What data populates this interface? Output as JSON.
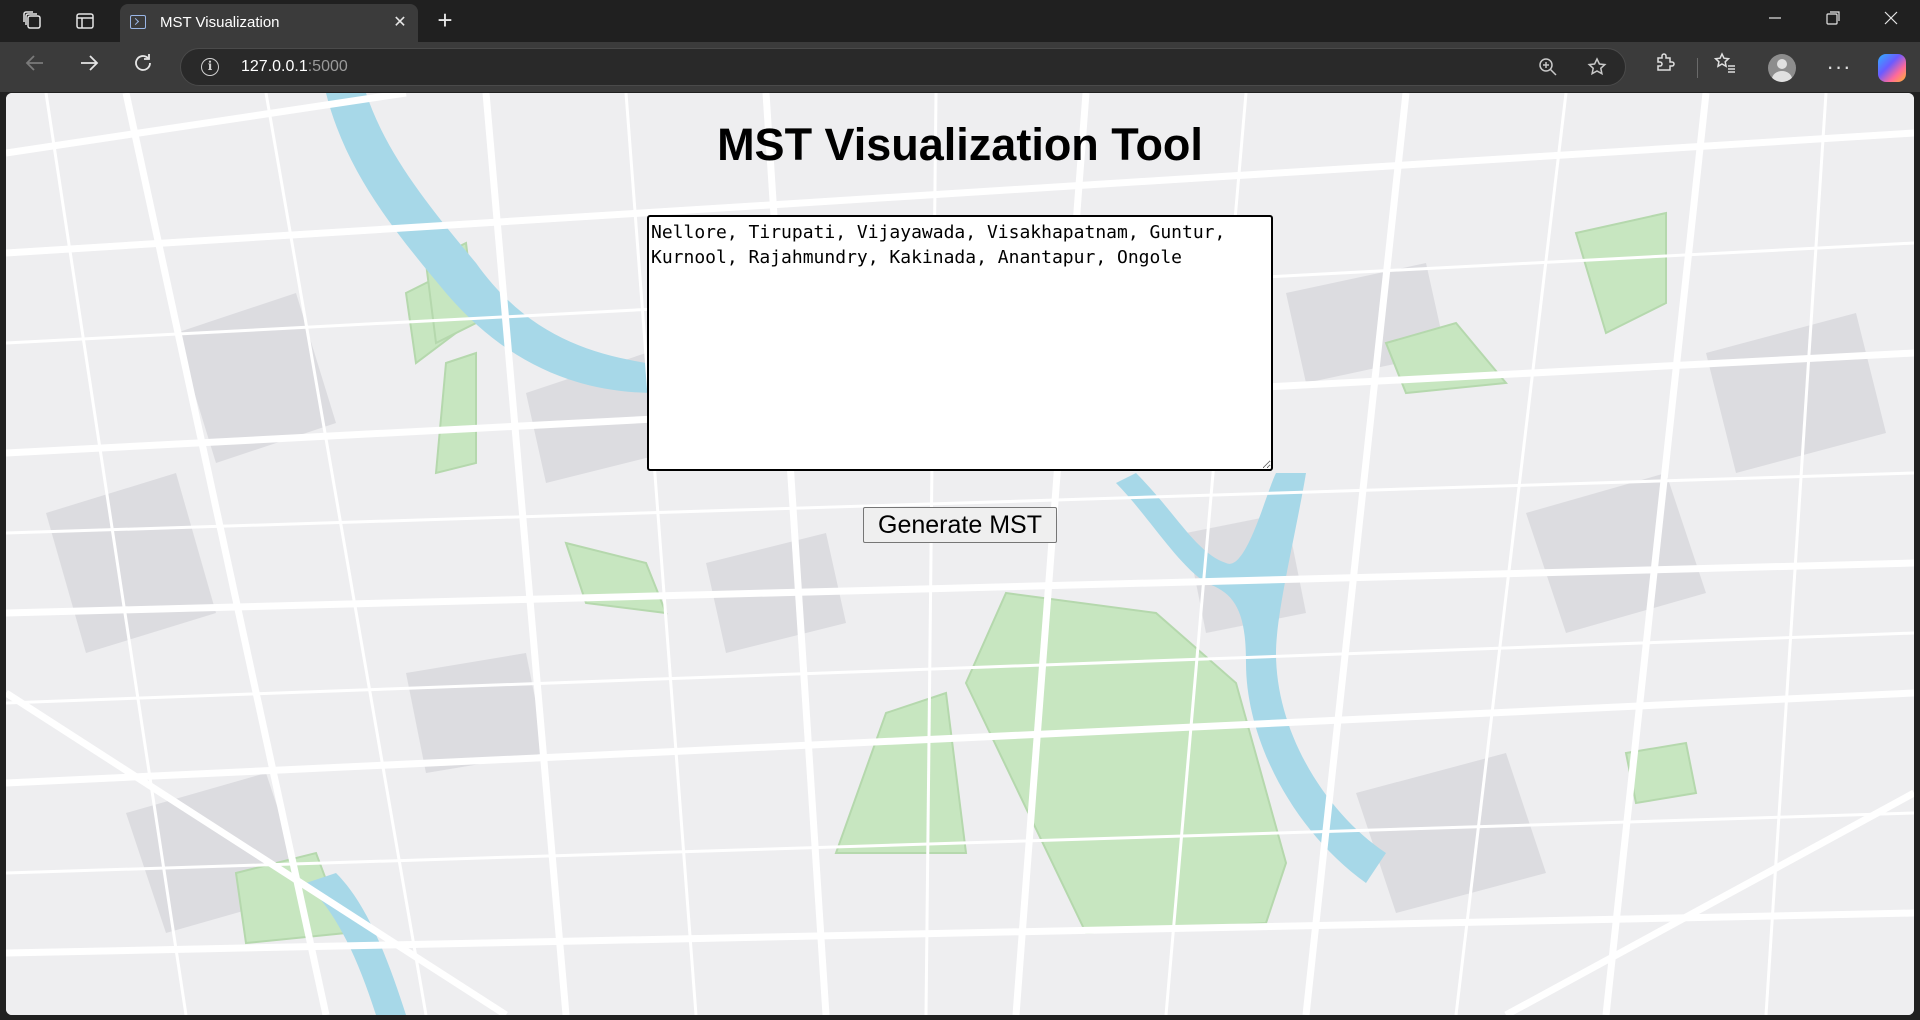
{
  "browser": {
    "tab_title": "MST Visualization",
    "tab_close_glyph": "✕",
    "new_tab_glyph": "+",
    "url_host": "127.0.0.1",
    "url_port": ":5000",
    "icons": [
      "workspaces-icon",
      "tab-actions-icon",
      "close-icon",
      "new-tab-icon",
      "minimize-icon",
      "maximize-icon",
      "window-close-icon",
      "back-icon",
      "forward-icon",
      "refresh-icon",
      "site-info-icon",
      "zoom-icon",
      "favorite-star-icon",
      "extensions-icon",
      "favorites-icon",
      "profile-icon",
      "more-icon",
      "copilot-icon"
    ]
  },
  "page": {
    "title": "MST Visualization Tool",
    "input_value": "Nellore, Tirupati, Vijayawada, Visakhapatnam, Guntur, Kurnool, Rajahmundry, Kakinada, Anantapur, Ongole",
    "button_label": "Generate MST"
  },
  "colors": {
    "map_background": "#eeeef0",
    "map_water": "#a7d8e8",
    "map_park": "#c7e6c0",
    "map_block": "#dcdce0"
  }
}
